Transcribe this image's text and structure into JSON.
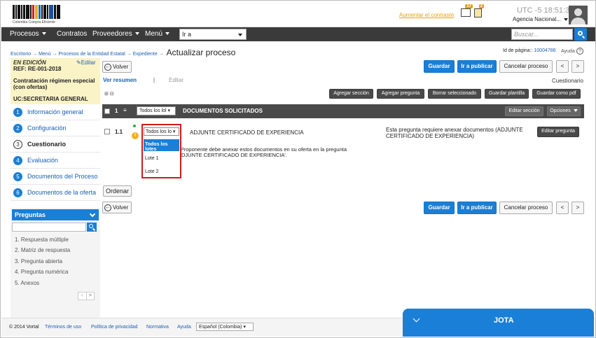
{
  "header": {
    "logo_text": "Colombia Compra Eficiente",
    "contrast_link": "Aumentar el contraste",
    "mail_badge": "17",
    "doc_badge": "2",
    "utc_label": "UTC -5",
    "time": "18:51:37",
    "agency": "Agencia Nacional..."
  },
  "nav": {
    "items": [
      "Procesos",
      "Contratos",
      "Proveedores",
      "Menú"
    ],
    "goto_value": "Ir a",
    "search_placeholder": "Buscar..."
  },
  "breadcrumb": {
    "items": [
      "Escritorio",
      "Menú",
      "Procesos de la Entidad Estatal",
      "Expediente"
    ],
    "current": "Actualizar proceso"
  },
  "page_id": {
    "label": "Id de página::",
    "value": "10004786"
  },
  "help": "Ayuda",
  "info": {
    "state": "EN EDICIÓN",
    "edit": "Editar",
    "ref": "REF: RE-001-2018",
    "contract": "Contratación régimen especial (con ofertas)",
    "uc": "UC:SECRETARIA GENERAL"
  },
  "steps": [
    {
      "num": "1",
      "label": "Información general"
    },
    {
      "num": "2",
      "label": "Configuración"
    },
    {
      "num": "3",
      "label": "Cuestionario"
    },
    {
      "num": "4",
      "label": "Evaluación"
    },
    {
      "num": "5",
      "label": "Documentos del Proceso"
    },
    {
      "num": "6",
      "label": "Documentos de la oferta"
    }
  ],
  "order_button": "Ordenar",
  "questions_panel": {
    "title": "Preguntas",
    "items": [
      "1. Respuesta múltiple",
      "2. Matriz de respuesta",
      "3. Pregunta abierta",
      "4. Pregunta numérica",
      "5. Anexos"
    ]
  },
  "actions": {
    "back": "Volver",
    "save": "Guardar",
    "publish": "Ir a publicar",
    "cancel": "Cancelar proceso",
    "prev": "<",
    "next": ">"
  },
  "view": {
    "summary": "Ver resumen",
    "sep": "|",
    "edit": "Editar",
    "tab_label": "Cuestionario"
  },
  "toolbar": [
    "Agregar sección",
    "Agregar pregunta",
    "Borrar seleccionado",
    "Guardar plantilla",
    "Guardar como pdf"
  ],
  "section": {
    "num": "1",
    "filter": "Todos los lol",
    "title": "DOCUMENTOS SOLICITADOS",
    "edit": "Editar sección",
    "options": "Opciones"
  },
  "question": {
    "num": "1.1",
    "lot_filter": "Todos los lo",
    "title": "ADJUNTE CERTIFICADO DE EXPERIENCIA",
    "note": "Esta pregunta requiere anexar documentos (ADJUNTE CERTIFICADO DE EXPERIENCIA)",
    "desc_line1": "l Proponente debe anexar estos documentos en su oferta en la pregunta",
    "desc_line2": "ADJUNTE CERTIFICADO DE EXPERIENCIA'.",
    "edit": "Editar pregunta"
  },
  "lot_options": [
    "Todos los lotes",
    "Lote 1",
    "Lote 2"
  ],
  "footer": {
    "copyright": "© 2014 Vortal",
    "links": [
      "Términos de uso",
      "Política de privacidad",
      "Normativa",
      "Ayuda"
    ],
    "language": "Español (Colombia)"
  },
  "chat": {
    "name": "JOTA"
  }
}
